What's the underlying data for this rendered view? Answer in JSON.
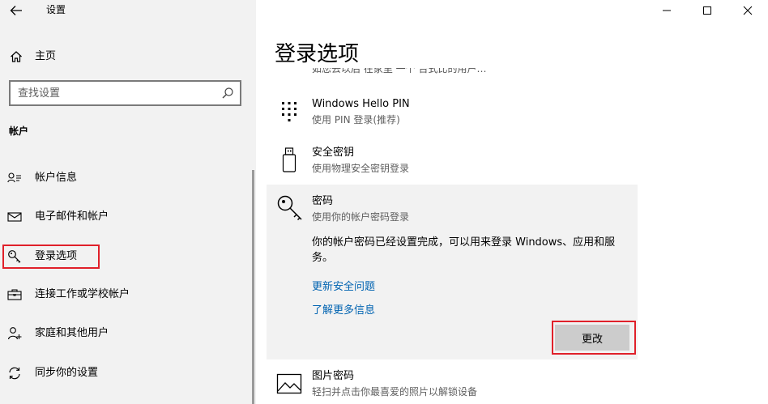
{
  "app": {
    "title": "设置"
  },
  "window_controls": {
    "minimize_icon": "minimize-icon",
    "maximize_icon": "maximize-icon",
    "close_icon": "close-icon"
  },
  "nav": {
    "home_label": "主页",
    "search_placeholder": "查找设置",
    "section_header": "帐户",
    "items": [
      {
        "label": "帐户信息",
        "icon": "account-info-icon"
      },
      {
        "label": "电子邮件和帐户",
        "icon": "mail-icon"
      },
      {
        "label": "登录选项",
        "icon": "key-icon",
        "selected": true
      },
      {
        "label": "连接工作或学校帐户",
        "icon": "briefcase-icon"
      },
      {
        "label": "家庭和其他用户",
        "icon": "person-add-icon"
      },
      {
        "label": "同步你的设置",
        "icon": "sync-icon"
      }
    ]
  },
  "main": {
    "page_title": "登录选项",
    "clipped_text": "如您去以后 在家里 一个 台式比的用户…",
    "options": [
      {
        "title": "Windows Hello PIN",
        "desc": "使用 PIN 登录(推荐)",
        "icon": "keypad-icon"
      },
      {
        "title": "安全密钥",
        "desc": "使用物理安全密钥登录",
        "icon": "usb-key-icon"
      },
      {
        "title": "密码",
        "desc": "使用你的帐户密码登录",
        "icon": "key-icon",
        "expanded": true
      },
      {
        "title": "图片密码",
        "desc": "轻扫并点击你最喜爱的照片以解锁设备",
        "icon": "picture-icon"
      }
    ],
    "password_card": {
      "description": "你的帐户密码已经设置完成，可以用来登录 Windows、应用和服务。",
      "link_security_questions": "更新安全问题",
      "link_learn_more": "了解更多信息",
      "change_button": "更改"
    }
  },
  "colors": {
    "nav_background": "#f2f2f2",
    "link": "#0063b1",
    "button": "#cccccc",
    "highlight_box": "#e0202a"
  }
}
